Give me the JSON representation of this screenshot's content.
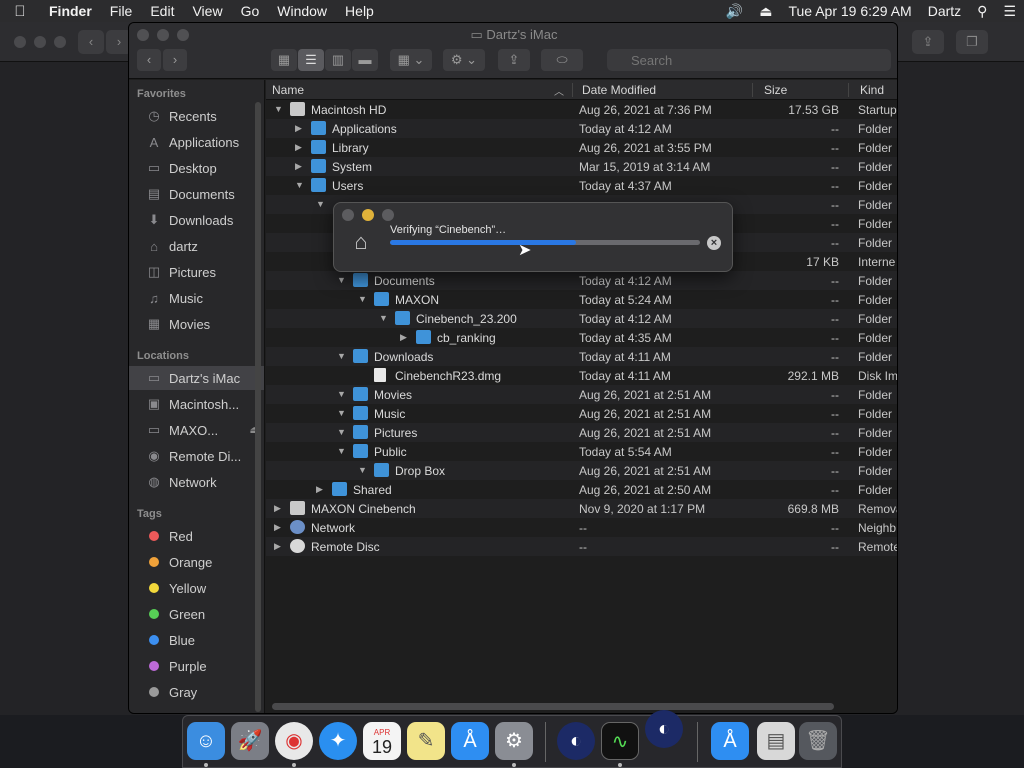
{
  "menubar": {
    "apple": "",
    "app_name": "Finder",
    "menus": [
      "File",
      "Edit",
      "View",
      "Go",
      "Window",
      "Help"
    ],
    "datetime": "Tue Apr 19  6:29 AM",
    "user": "Dartz"
  },
  "window": {
    "title": "Dartz's iMac",
    "search_placeholder": "Search"
  },
  "sidebar": {
    "favorites_header": "Favorites",
    "favorites": [
      "Recents",
      "Applications",
      "Desktop",
      "Documents",
      "Downloads",
      "dartz",
      "Pictures",
      "Music",
      "Movies"
    ],
    "locations_header": "Locations",
    "locations": [
      "Dartz's iMac",
      "Macintosh...",
      "MAXO...",
      "Remote Di...",
      "Network"
    ],
    "tags_header": "Tags",
    "tags": [
      {
        "label": "Red",
        "color": "#ee5a5a"
      },
      {
        "label": "Orange",
        "color": "#f0a23a"
      },
      {
        "label": "Yellow",
        "color": "#f2d83b"
      },
      {
        "label": "Green",
        "color": "#57cf56"
      },
      {
        "label": "Blue",
        "color": "#3c8ff0"
      },
      {
        "label": "Purple",
        "color": "#bd6ad8"
      },
      {
        "label": "Gray",
        "color": "#9a9a9a"
      }
    ]
  },
  "columns": {
    "name": "Name",
    "date": "Date Modified",
    "size": "Size",
    "kind": "Kind"
  },
  "rows": [
    {
      "name": "Macintosh HD",
      "date": "Aug 26, 2021 at 7:36 PM",
      "size": "17.53 GB",
      "kind": "Startup"
    },
    {
      "name": "Applications",
      "date": "Today at 4:12 AM",
      "size": "--",
      "kind": "Folder"
    },
    {
      "name": "Library",
      "date": "Aug 26, 2021 at 3:55 PM",
      "size": "--",
      "kind": "Folder"
    },
    {
      "name": "System",
      "date": "Mar 15, 2019 at 3:14 AM",
      "size": "--",
      "kind": "Folder"
    },
    {
      "name": "Users",
      "date": "Today at 4:37 AM",
      "size": "--",
      "kind": "Folder"
    },
    {
      "name": "",
      "date": "",
      "size": "--",
      "kind": "Folder"
    },
    {
      "name": "",
      "date": "",
      "size": "--",
      "kind": "Folder"
    },
    {
      "name": "",
      "date": "",
      "size": "--",
      "kind": "Folder"
    },
    {
      "name": "",
      "date": "",
      "size": "17 KB",
      "kind": "Interne"
    },
    {
      "name": "Documents",
      "date": "Today at 4:12 AM",
      "size": "--",
      "kind": "Folder"
    },
    {
      "name": "MAXON",
      "date": "Today at 5:24 AM",
      "size": "--",
      "kind": "Folder"
    },
    {
      "name": "Cinebench_23.200",
      "date": "Today at 4:12 AM",
      "size": "--",
      "kind": "Folder"
    },
    {
      "name": "cb_ranking",
      "date": "Today at 4:35 AM",
      "size": "--",
      "kind": "Folder"
    },
    {
      "name": "Downloads",
      "date": "Today at 4:11 AM",
      "size": "--",
      "kind": "Folder"
    },
    {
      "name": "CinebenchR23.dmg",
      "date": "Today at 4:11 AM",
      "size": "292.1 MB",
      "kind": "Disk Im"
    },
    {
      "name": "Movies",
      "date": "Aug 26, 2021 at 2:51 AM",
      "size": "--",
      "kind": "Folder"
    },
    {
      "name": "Music",
      "date": "Aug 26, 2021 at 2:51 AM",
      "size": "--",
      "kind": "Folder"
    },
    {
      "name": "Pictures",
      "date": "Aug 26, 2021 at 2:51 AM",
      "size": "--",
      "kind": "Folder"
    },
    {
      "name": "Public",
      "date": "Today at 5:54 AM",
      "size": "--",
      "kind": "Folder"
    },
    {
      "name": "Drop Box",
      "date": "Aug 26, 2021 at 2:51 AM",
      "size": "--",
      "kind": "Folder"
    },
    {
      "name": "Shared",
      "date": "Aug 26, 2021 at 2:50 AM",
      "size": "--",
      "kind": "Folder"
    },
    {
      "name": "MAXON Cinebench",
      "date": "Nov 9, 2020 at 1:17 PM",
      "size": "669.8 MB",
      "kind": "Remova"
    },
    {
      "name": "Network",
      "date": "--",
      "size": "--",
      "kind": "Neighb"
    },
    {
      "name": "Remote Disc",
      "date": "--",
      "size": "--",
      "kind": "Remote"
    }
  ],
  "dialog": {
    "message": "Verifying “Cinebench”…",
    "progress": 0.6
  },
  "dock": {
    "calendar_month": "APR",
    "calendar_day": "19"
  }
}
